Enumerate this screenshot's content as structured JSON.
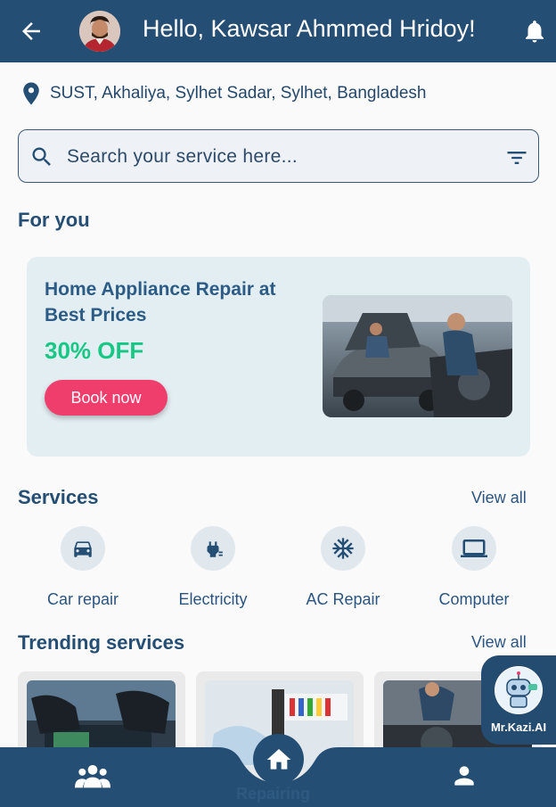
{
  "header": {
    "greeting": "Hello, Kawsar Ahmmed Hridoy!",
    "back_icon": "arrow-left-icon",
    "notification_icon": "bell-icon",
    "bar_color": "#254e74"
  },
  "location": {
    "icon": "map-pin-icon",
    "text": "SUST, Akhaliya, Sylhet Sadar, Sylhet, Bangladesh"
  },
  "search": {
    "placeholder": "Search your service here...",
    "value": "",
    "search_icon": "search-icon",
    "filter_icon": "filter-icon"
  },
  "for_you": {
    "title": "For you",
    "promo": {
      "title": "Home Appliance Repair at Best Prices",
      "discount": "30% OFF",
      "button_label": "Book now",
      "discount_color": "#16c785",
      "button_color": "#ef3d6c"
    }
  },
  "services": {
    "title": "Services",
    "view_all": "View all",
    "items": [
      {
        "label": "Car repair",
        "icon": "car-icon"
      },
      {
        "label": "Electricity",
        "icon": "power-plug-icon"
      },
      {
        "label": "AC Repair",
        "icon": "snowflake-icon"
      },
      {
        "label": "Computer",
        "icon": "laptop-icon"
      }
    ]
  },
  "trending": {
    "title": "Trending services",
    "view_all": "View all"
  },
  "assistant": {
    "label": "Mr.Kazi.AI",
    "icon": "robot-icon"
  },
  "bottom_nav": {
    "items": [
      {
        "name": "community",
        "icon": "people-icon"
      },
      {
        "name": "home",
        "icon": "home-icon"
      },
      {
        "name": "profile",
        "icon": "person-icon"
      }
    ],
    "caption": "Repairing"
  }
}
